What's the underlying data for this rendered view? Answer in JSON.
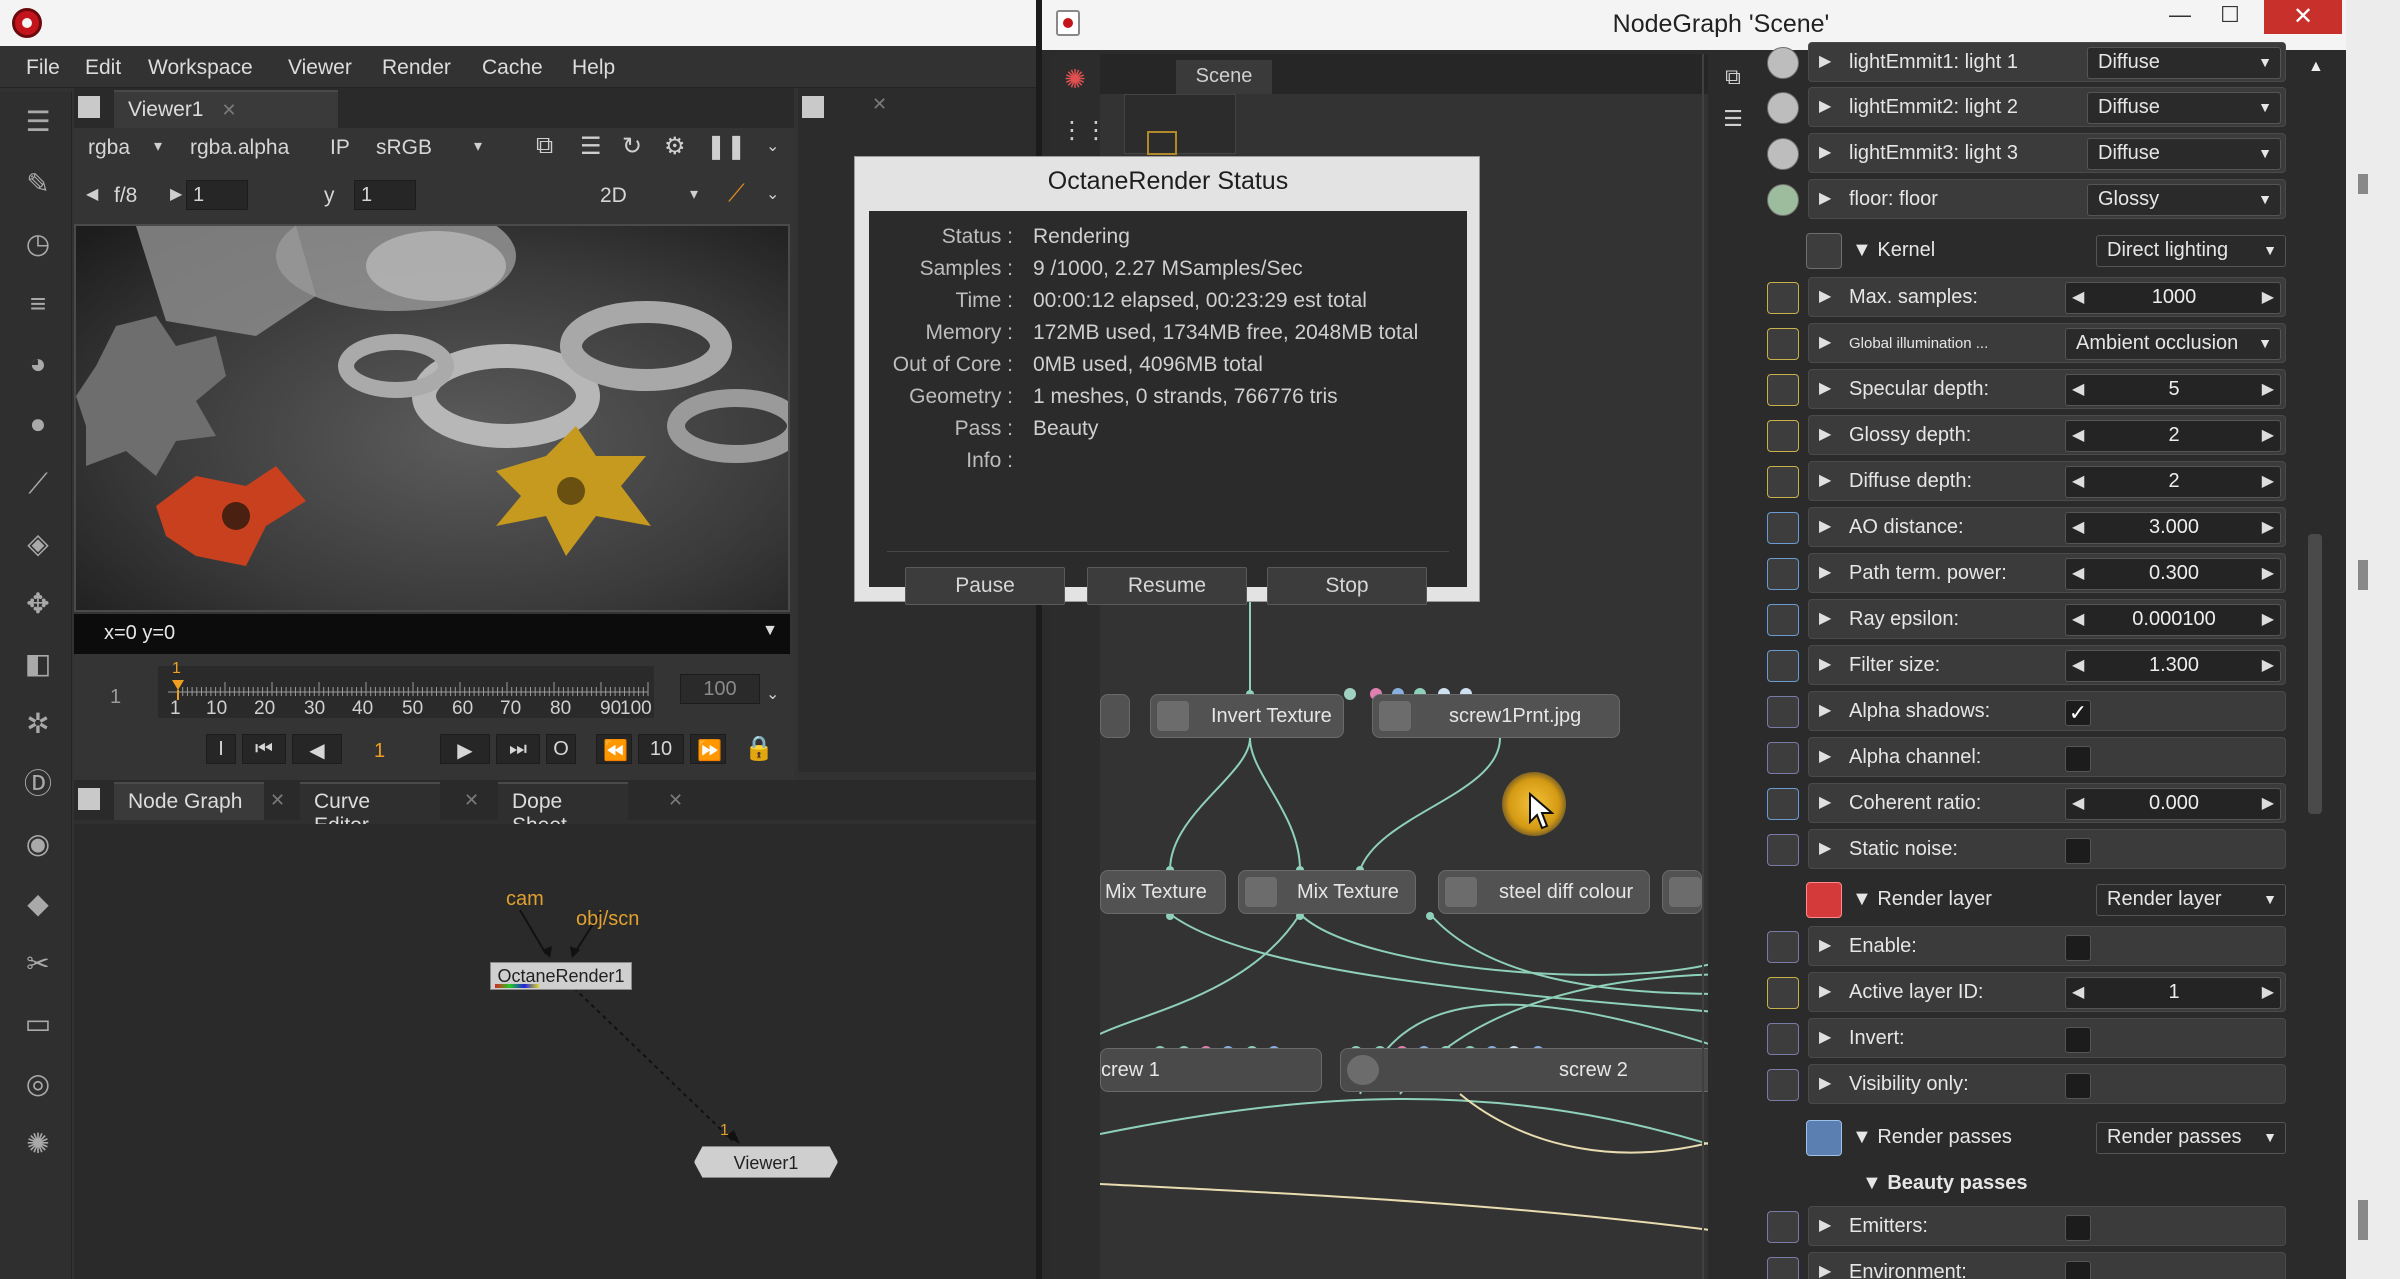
{
  "left_window": {
    "menu": [
      "File",
      "Edit",
      "Workspace",
      "Viewer",
      "Render",
      "Cache",
      "Help"
    ],
    "toolbar_icons": [
      "viewer-tool-icon",
      "paint-icon",
      "clock-icon",
      "channel-icon",
      "color-wheel-icon",
      "circle-icon",
      "filter-icon",
      "layers-icon",
      "transform-icon",
      "cube-icon",
      "particles-icon",
      "d-icon",
      "eye-icon",
      "tag-icon",
      "tools-icon",
      "box-icon",
      "octane-icon",
      "swirl-icon"
    ],
    "viewer": {
      "tab_label": "Viewer1",
      "channels": "rgba",
      "alpha": "rgba.alpha",
      "ip": "IP",
      "colorspace": "sRGB",
      "fstop": "f/8",
      "gain": "1",
      "y_label": "y",
      "y_value": "1",
      "view_mode": "2D",
      "coords": "x=0 y=0",
      "frame_start": "1",
      "frame_end": "100",
      "playhead_frame": "1",
      "ticks": [
        "1",
        "10",
        "20",
        "30",
        "40",
        "50",
        "60",
        "70",
        "80",
        "90",
        "100"
      ],
      "current_frame": "1",
      "step": "10",
      "transport_i": "I",
      "transport_o": "O"
    },
    "bottom_tabs": [
      "Node Graph",
      "Curve Editor",
      "Dope Sheet"
    ],
    "nodegraph": {
      "input_cam": "cam",
      "input_obj": "obj/scn",
      "render_node": "OctaneRender1",
      "viewer_node": "Viewer1",
      "viewer_input": "1"
    }
  },
  "right_window": {
    "title": "NodeGraph 'Scene'",
    "minimize": "—",
    "maximize": "☐",
    "close": "✕",
    "scene_tab": "Scene",
    "nodes": [
      {
        "label": "Invert Texture"
      },
      {
        "label": "screw1Prnt.jpg"
      },
      {
        "label": "Mix Texture"
      },
      {
        "label": "Mix Texture"
      },
      {
        "label": "steel diff colour"
      },
      {
        "label": "crew 1"
      },
      {
        "label": "screw 2"
      }
    ]
  },
  "properties": {
    "lights": [
      {
        "label": "lightEmmit1: light 1",
        "value": "Diffuse"
      },
      {
        "label": "lightEmmit2: light 2",
        "value": "Diffuse"
      },
      {
        "label": "lightEmmit3: light 3",
        "value": "Diffuse"
      },
      {
        "label": "floor: floor",
        "value": "Glossy"
      }
    ],
    "kernel": {
      "label": "Kernel",
      "mode": "Direct lighting",
      "params": [
        {
          "label": "Max. samples:",
          "value": "1000",
          "kind": "spinner"
        },
        {
          "label": "Global illumination ...",
          "value": "Ambient occlusion",
          "kind": "dropdown"
        },
        {
          "label": "Specular depth:",
          "value": "5",
          "kind": "spinner"
        },
        {
          "label": "Glossy depth:",
          "value": "2",
          "kind": "spinner"
        },
        {
          "label": "Diffuse depth:",
          "value": "2",
          "kind": "spinner"
        },
        {
          "label": "AO distance:",
          "value": "3.000",
          "kind": "spinner"
        },
        {
          "label": "Path term. power:",
          "value": "0.300",
          "kind": "spinner"
        },
        {
          "label": "Ray epsilon:",
          "value": "0.000100",
          "kind": "spinner"
        },
        {
          "label": "Filter size:",
          "value": "1.300",
          "kind": "spinner"
        },
        {
          "label": "Alpha shadows:",
          "value": "✓",
          "kind": "checkbox"
        },
        {
          "label": "Alpha channel:",
          "value": "",
          "kind": "checkbox"
        },
        {
          "label": "Coherent ratio:",
          "value": "0.000",
          "kind": "spinner"
        },
        {
          "label": "Static noise:",
          "value": "",
          "kind": "checkbox"
        }
      ]
    },
    "render_layer": {
      "label": "Render layer",
      "mode": "Render layer",
      "params": [
        {
          "label": "Enable:",
          "value": "",
          "kind": "checkbox"
        },
        {
          "label": "Active layer ID:",
          "value": "1",
          "kind": "spinner"
        },
        {
          "label": "Invert:",
          "value": "",
          "kind": "checkbox"
        },
        {
          "label": "Visibility only:",
          "value": "",
          "kind": "checkbox"
        }
      ]
    },
    "render_passes": {
      "label": "Render passes",
      "mode": "Render passes",
      "subheading": "Beauty passes",
      "params": [
        {
          "label": "Emitters:",
          "value": "",
          "kind": "checkbox"
        },
        {
          "label": "Environment:",
          "value": "",
          "kind": "checkbox"
        }
      ]
    }
  },
  "status_dialog": {
    "title": "OctaneRender Status",
    "rows": [
      {
        "key": "Status :",
        "value": "Rendering"
      },
      {
        "key": "Samples :",
        "value": "9 /1000, 2.27 MSamples/Sec"
      },
      {
        "key": "Time :",
        "value": "00:00:12 elapsed, 00:23:29 est total"
      },
      {
        "key": "Memory :",
        "value": "172MB used, 1734MB free, 2048MB total"
      },
      {
        "key": "Out of Core :",
        "value": "0MB used, 4096MB total"
      },
      {
        "key": "Geometry :",
        "value": "1 meshes, 0 strands, 766776 tris"
      },
      {
        "key": "Pass :",
        "value": "Beauty"
      },
      {
        "key": "Info :",
        "value": ""
      }
    ],
    "buttons": [
      "Pause",
      "Resume",
      "Stop"
    ]
  }
}
